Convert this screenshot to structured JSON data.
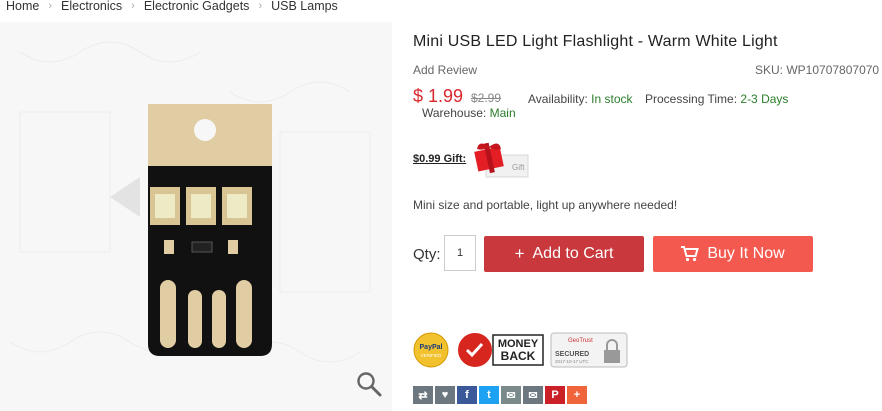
{
  "breadcrumb": [
    "Home",
    "Electronics",
    "Electronic Gadgets",
    "USB Lamps"
  ],
  "product": {
    "title": "Mini USB LED Light Flashlight - Warm White Light",
    "add_review": "Add Review",
    "sku": "SKU: WP10707807070",
    "price": "$ 1.99",
    "old_price": "$2.99",
    "availability_label": "Availability:",
    "availability_value": "In stock",
    "processing_label": "Processing Time:",
    "processing_value": "2-3 Days",
    "warehouse_label": "Warehouse:",
    "warehouse_value": "Main",
    "gift_label": "$0.99 Gift:",
    "gift_tag": "Gift",
    "description": "Mini size and portable, light up anywhere needed!",
    "qty_label": "Qty:",
    "qty_value": "1",
    "add_to_cart": "Add to Cart",
    "buy_now": "Buy It Now"
  },
  "badges": {
    "paypal": [
      "PayPal",
      "VERIFIED"
    ],
    "money_back": [
      "MONEY",
      "BACK"
    ],
    "geotrust": [
      "GeoTrust",
      "SECURED",
      "2017-10-17 UTC"
    ]
  },
  "share_icons": [
    {
      "icon": "compare-icon",
      "color": "#6d7780",
      "glyph": "⇄"
    },
    {
      "icon": "heart-icon",
      "color": "#6d7780",
      "glyph": "♥"
    },
    {
      "icon": "facebook-icon",
      "color": "#3b5998",
      "glyph": "f"
    },
    {
      "icon": "twitter-icon",
      "color": "#1da1f2",
      "glyph": "t"
    },
    {
      "icon": "vk-icon",
      "color": "#7a8a8a",
      "glyph": "✉"
    },
    {
      "icon": "email-icon",
      "color": "#6d7780",
      "glyph": "✉"
    },
    {
      "icon": "pinterest-icon",
      "color": "#cb2027",
      "glyph": "P"
    },
    {
      "icon": "more-icon",
      "color": "#f0643c",
      "glyph": "+"
    }
  ],
  "colors": {
    "price": "#d9272e",
    "add_to_cart": "#c8383c",
    "buy_now": "#f4594f",
    "in_stock": "#2a7d2a"
  }
}
